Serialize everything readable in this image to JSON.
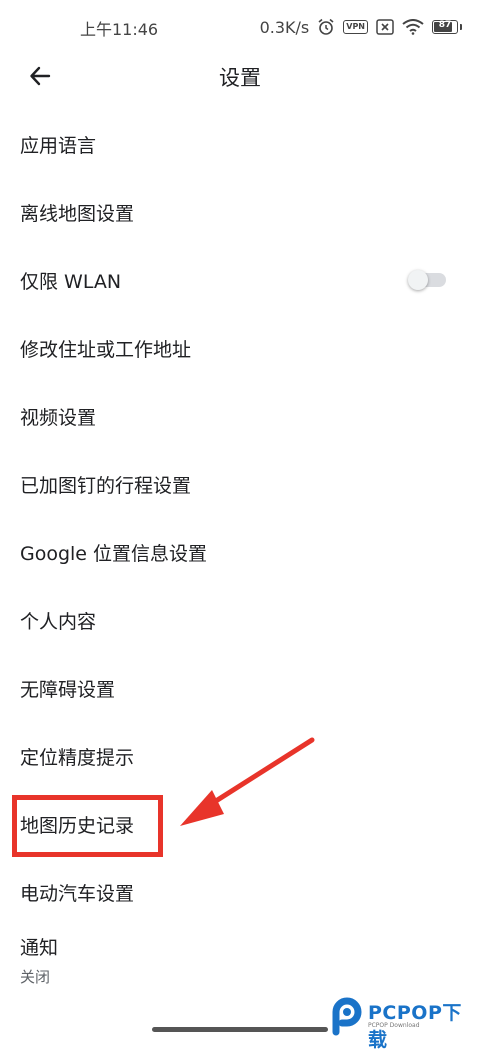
{
  "status_bar": {
    "time": "上午11:46",
    "network_speed": "0.3K/s",
    "vpn_label": "VPN",
    "battery_level": "87",
    "battery_fraction": 0.87,
    "icons": [
      "alarm-icon",
      "vpn-icon",
      "sim-off-icon",
      "wifi-icon",
      "battery-icon"
    ]
  },
  "app_bar": {
    "title": "设置",
    "back_icon": "back-arrow-icon"
  },
  "settings": {
    "items": [
      {
        "label": "应用语言"
      },
      {
        "label": "离线地图设置"
      },
      {
        "label": "仅限 WLAN",
        "toggle": false
      },
      {
        "label": "修改住址或工作地址"
      },
      {
        "label": "视频设置"
      },
      {
        "label": "已加图钉的行程设置"
      },
      {
        "label": "Google 位置信息设置"
      },
      {
        "label": "个人内容"
      },
      {
        "label": "无障碍设置"
      },
      {
        "label": "定位精度提示"
      },
      {
        "label": "地图历史记录"
      },
      {
        "label": "电动汽车设置"
      },
      {
        "label": "通知",
        "sublabel": "关闭"
      }
    ]
  },
  "annotation": {
    "highlight_color": "#e8342a",
    "target_item": "地图历史记录"
  },
  "watermark": {
    "text": "PCPOP下载",
    "subtext": "PCPOP Download",
    "color": "#1a73c8"
  }
}
